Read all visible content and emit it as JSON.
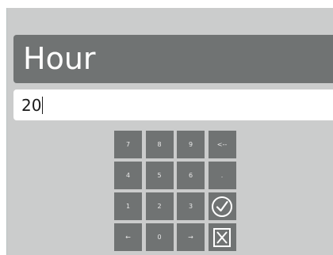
{
  "dialog": {
    "title": "Hour",
    "value": "20"
  },
  "keypad": {
    "rows": [
      [
        {
          "label": "7",
          "name": "key-7"
        },
        {
          "label": "8",
          "name": "key-8"
        },
        {
          "label": "9",
          "name": "key-9"
        },
        {
          "label": "<--",
          "name": "key-backspace"
        }
      ],
      [
        {
          "label": "4",
          "name": "key-4"
        },
        {
          "label": "5",
          "name": "key-5"
        },
        {
          "label": "6",
          "name": "key-6"
        },
        {
          "label": ".",
          "name": "key-decimal"
        }
      ],
      [
        {
          "label": "1",
          "name": "key-1"
        },
        {
          "label": "2",
          "name": "key-2"
        },
        {
          "label": "3",
          "name": "key-3"
        },
        {
          "icon": "confirm-check-icon",
          "name": "confirm-button"
        }
      ],
      [
        {
          "label": "←",
          "name": "key-left-arrow"
        },
        {
          "label": "0",
          "name": "key-0"
        },
        {
          "label": "→",
          "name": "key-right-arrow"
        },
        {
          "icon": "cancel-x-icon",
          "name": "cancel-button"
        }
      ]
    ]
  },
  "colors": {
    "panel": "#cbcccc",
    "title_bar": "#707373",
    "key": "#707373",
    "key_text": "#e8e8e8"
  }
}
